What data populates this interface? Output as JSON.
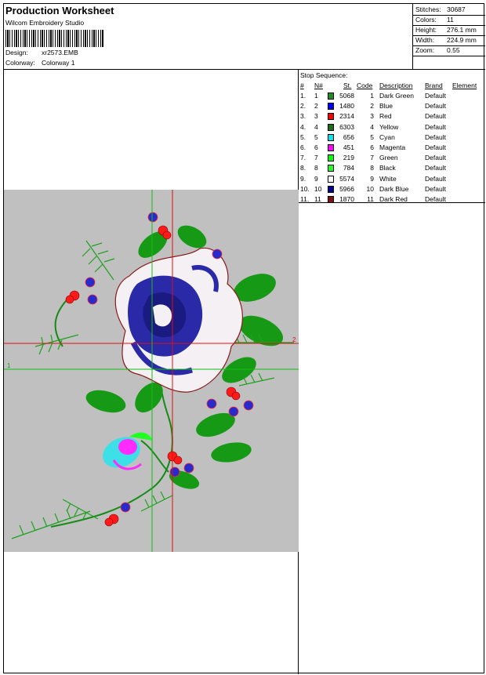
{
  "header": {
    "title": "Production Worksheet",
    "app": "Wilcom Embroidery Studio",
    "design_label": "Design:",
    "design_value": "xr2573.EMB",
    "colorway_label": "Colorway:",
    "colorway_value": "Colorway 1"
  },
  "stats": [
    {
      "label": "Stitches:",
      "value": "30687"
    },
    {
      "label": "Colors:",
      "value": "11"
    },
    {
      "label": "Height:",
      "value": "276.1 mm"
    },
    {
      "label": "Width:",
      "value": "224.9 mm"
    },
    {
      "label": "Zoom:",
      "value": "0.55"
    }
  ],
  "stop_sequence": {
    "title": "Stop Sequence:",
    "headers": {
      "num": "#",
      "nnum": "N#",
      "st": "St.",
      "code": "Code",
      "desc": "Description",
      "brand": "Brand",
      "element": "Element"
    },
    "rows": [
      {
        "num": "1.",
        "nnum": "1",
        "st": "5068",
        "code": "1",
        "desc": "Dark Green",
        "brand": "Default",
        "color": "#1e8c1e"
      },
      {
        "num": "2.",
        "nnum": "2",
        "st": "1480",
        "code": "2",
        "desc": "Blue",
        "brand": "Default",
        "color": "#0000ff"
      },
      {
        "num": "3.",
        "nnum": "3",
        "st": "2314",
        "code": "3",
        "desc": "Red",
        "brand": "Default",
        "color": "#ff0000"
      },
      {
        "num": "4.",
        "nnum": "4",
        "st": "6303",
        "code": "4",
        "desc": "Yellow",
        "brand": "Default",
        "color": "#1a6e1a"
      },
      {
        "num": "5.",
        "nnum": "5",
        "st": "656",
        "code": "5",
        "desc": "Cyan",
        "brand": "Default",
        "color": "#00e5ee"
      },
      {
        "num": "6.",
        "nnum": "6",
        "st": "451",
        "code": "6",
        "desc": "Magenta",
        "brand": "Default",
        "color": "#ff00ff"
      },
      {
        "num": "7.",
        "nnum": "7",
        "st": "219",
        "code": "7",
        "desc": "Green",
        "brand": "Default",
        "color": "#00ff00"
      },
      {
        "num": "8.",
        "nnum": "8",
        "st": "784",
        "code": "8",
        "desc": "Black",
        "brand": "Default",
        "color": "#22ff22"
      },
      {
        "num": "9.",
        "nnum": "9",
        "st": "5574",
        "code": "9",
        "desc": "White",
        "brand": "Default",
        "color": "#ffffff"
      },
      {
        "num": "10.",
        "nnum": "10",
        "st": "5966",
        "code": "10",
        "desc": "Dark Blue",
        "brand": "Default",
        "color": "#000090"
      },
      {
        "num": "11.",
        "nnum": "11",
        "st": "1870",
        "code": "11",
        "desc": "Dark Red",
        "brand": "Default",
        "color": "#7a1010"
      }
    ]
  },
  "preview": {
    "marker_left": "1",
    "marker_right": "2"
  }
}
